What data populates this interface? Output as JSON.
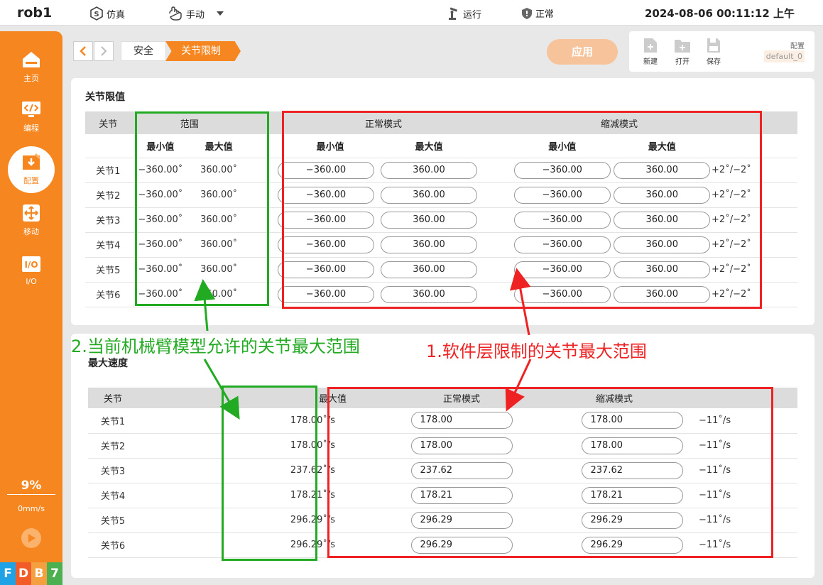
{
  "header": {
    "robot_name": "rob1",
    "sim_label": "仿真",
    "mode_label": "手动",
    "run_label": "运行",
    "safety_label": "正常",
    "datetime": "2024-08-06 00:11:12 上午"
  },
  "sidebar": {
    "items": [
      {
        "label": "主页",
        "icon": "home-icon"
      },
      {
        "label": "编程",
        "icon": "code-icon"
      },
      {
        "label": "配置",
        "icon": "config-icon"
      },
      {
        "label": "移动",
        "icon": "move-icon"
      },
      {
        "label": "I/O",
        "icon": "io-icon"
      }
    ],
    "active_index": 2,
    "speed_percent": "9%",
    "speed_mm": "0mm/s",
    "status_letters": [
      {
        "letter": "F",
        "color": "#1fa3e6"
      },
      {
        "letter": "D",
        "color": "#f25c28"
      },
      {
        "letter": "B",
        "color": "#f5a040"
      },
      {
        "letter": "7",
        "color": "#4caf50"
      }
    ]
  },
  "breadcrumb": {
    "parent": "安全",
    "current": "关节限制"
  },
  "toolbar": {
    "apply_label": "应用",
    "new_label": "新建",
    "open_label": "打开",
    "save_label": "保存",
    "config_label": "配置",
    "config_value": "default_0"
  },
  "joint_limits": {
    "title": "关节限值",
    "col_joint": "关节",
    "col_range": "范围",
    "col_normal": "正常模式",
    "col_reduced": "缩减模式",
    "sub_min": "最小值",
    "sub_max": "最大值",
    "rows": [
      {
        "joint": "关节1",
        "range_min": "−360.00˚",
        "range_max": "360.00˚",
        "normal_min": "−360.00",
        "normal_max": "360.00",
        "reduced_min": "−360.00",
        "reduced_max": "360.00",
        "tolerance": "+2˚/−2˚"
      },
      {
        "joint": "关节2",
        "range_min": "−360.00˚",
        "range_max": "360.00˚",
        "normal_min": "−360.00",
        "normal_max": "360.00",
        "reduced_min": "−360.00",
        "reduced_max": "360.00",
        "tolerance": "+2˚/−2˚"
      },
      {
        "joint": "关节3",
        "range_min": "−360.00˚",
        "range_max": "360.00˚",
        "normal_min": "−360.00",
        "normal_max": "360.00",
        "reduced_min": "−360.00",
        "reduced_max": "360.00",
        "tolerance": "+2˚/−2˚"
      },
      {
        "joint": "关节4",
        "range_min": "−360.00˚",
        "range_max": "360.00˚",
        "normal_min": "−360.00",
        "normal_max": "360.00",
        "reduced_min": "−360.00",
        "reduced_max": "360.00",
        "tolerance": "+2˚/−2˚"
      },
      {
        "joint": "关节5",
        "range_min": "−360.00˚",
        "range_max": "360.00˚",
        "normal_min": "−360.00",
        "normal_max": "360.00",
        "reduced_min": "−360.00",
        "reduced_max": "360.00",
        "tolerance": "+2˚/−2˚"
      },
      {
        "joint": "关节6",
        "range_min": "−360.00˚",
        "range_max": "360.00˚",
        "normal_min": "−360.00",
        "normal_max": "360.00",
        "reduced_min": "−360.00",
        "reduced_max": "360.00",
        "tolerance": "+2˚/−2˚"
      }
    ]
  },
  "max_speed": {
    "title": "最大速度",
    "col_joint": "关节",
    "col_max": "最大值",
    "col_normal": "正常模式",
    "col_reduced": "缩减模式",
    "rows": [
      {
        "joint": "关节1",
        "max": "178.00˚/s",
        "normal": "178.00",
        "reduced": "178.00",
        "tolerance": "−11˚/s"
      },
      {
        "joint": "关节2",
        "max": "178.00˚/s",
        "normal": "178.00",
        "reduced": "178.00",
        "tolerance": "−11˚/s"
      },
      {
        "joint": "关节3",
        "max": "237.62˚/s",
        "normal": "237.62",
        "reduced": "237.62",
        "tolerance": "−11˚/s"
      },
      {
        "joint": "关节4",
        "max": "178.21˚/s",
        "normal": "178.21",
        "reduced": "178.21",
        "tolerance": "−11˚/s"
      },
      {
        "joint": "关节5",
        "max": "296.29˚/s",
        "normal": "296.29",
        "reduced": "296.29",
        "tolerance": "−11˚/s"
      },
      {
        "joint": "关节6",
        "max": "296.29˚/s",
        "normal": "296.29",
        "reduced": "296.29",
        "tolerance": "−11˚/s"
      }
    ]
  },
  "annotations": {
    "green_text": "2.当前机械臂模型允许的关节最大范围",
    "red_text": "1.软件层限制的关节最大范围",
    "green_color": "#22aa22",
    "red_color": "#ee2222"
  }
}
